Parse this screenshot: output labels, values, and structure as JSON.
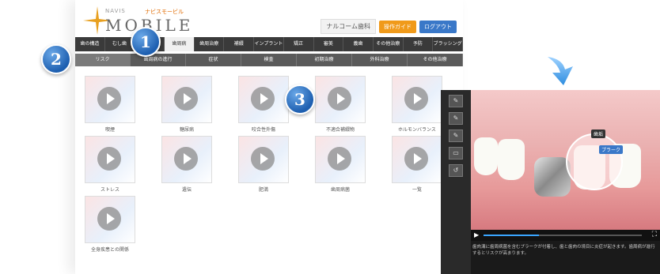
{
  "app": {
    "logo_small": "NAVIS",
    "logo_small_jp": "ナビスモービル",
    "logo_name": "MOBILE",
    "clinic_name": "ナルコーム歯科",
    "guide_button": "操作ガイド",
    "logout_button": "ログアウト"
  },
  "nav_primary": [
    {
      "label": "歯の構造",
      "active": false
    },
    {
      "label": "むし歯",
      "active": false
    },
    {
      "label": "",
      "active": false
    },
    {
      "label": "歯周病",
      "active": true
    },
    {
      "label": "歯周治療",
      "active": false
    },
    {
      "label": "補綴",
      "active": false
    },
    {
      "label": "インプラント",
      "active": false
    },
    {
      "label": "矯正",
      "active": false
    },
    {
      "label": "審美",
      "active": false
    },
    {
      "label": "義歯",
      "active": false
    },
    {
      "label": "その他治療",
      "active": false
    },
    {
      "label": "予防",
      "active": false
    },
    {
      "label": "ブラッシング",
      "active": false
    }
  ],
  "nav_secondary": [
    {
      "label": "リスク",
      "active": true
    },
    {
      "label": "歯周病の進行",
      "active": false
    },
    {
      "label": "症状",
      "active": false
    },
    {
      "label": "検査",
      "active": false
    },
    {
      "label": "初期治療",
      "active": false
    },
    {
      "label": "外科治療",
      "active": false
    },
    {
      "label": "その他治療",
      "active": false
    }
  ],
  "videos": [
    {
      "label": "喫煙"
    },
    {
      "label": "糖尿病"
    },
    {
      "label": "咬合性外傷"
    },
    {
      "label": "不適合補綴物"
    },
    {
      "label": "ホルモンバランス"
    },
    {
      "label": "ストレス"
    },
    {
      "label": "遺伝"
    },
    {
      "label": "肥満"
    },
    {
      "label": "歯周病菌"
    },
    {
      "label": "一覧"
    },
    {
      "label": "全身疾患との関係"
    }
  ],
  "badges": [
    "1",
    "2",
    "3"
  ],
  "player": {
    "tools": [
      "pen-icon",
      "pen-icon",
      "pen-icon",
      "eraser-icon",
      "undo-icon"
    ],
    "tag_1": "歯垢",
    "tag_2": "プラーク",
    "progress": 0.35,
    "subtitle": "歯肉溝に歯周病菌を含むプラークが付着し、歯と歯肉の境目に炎症が起きます。歯周病が進行するとリスクが高まります。"
  }
}
